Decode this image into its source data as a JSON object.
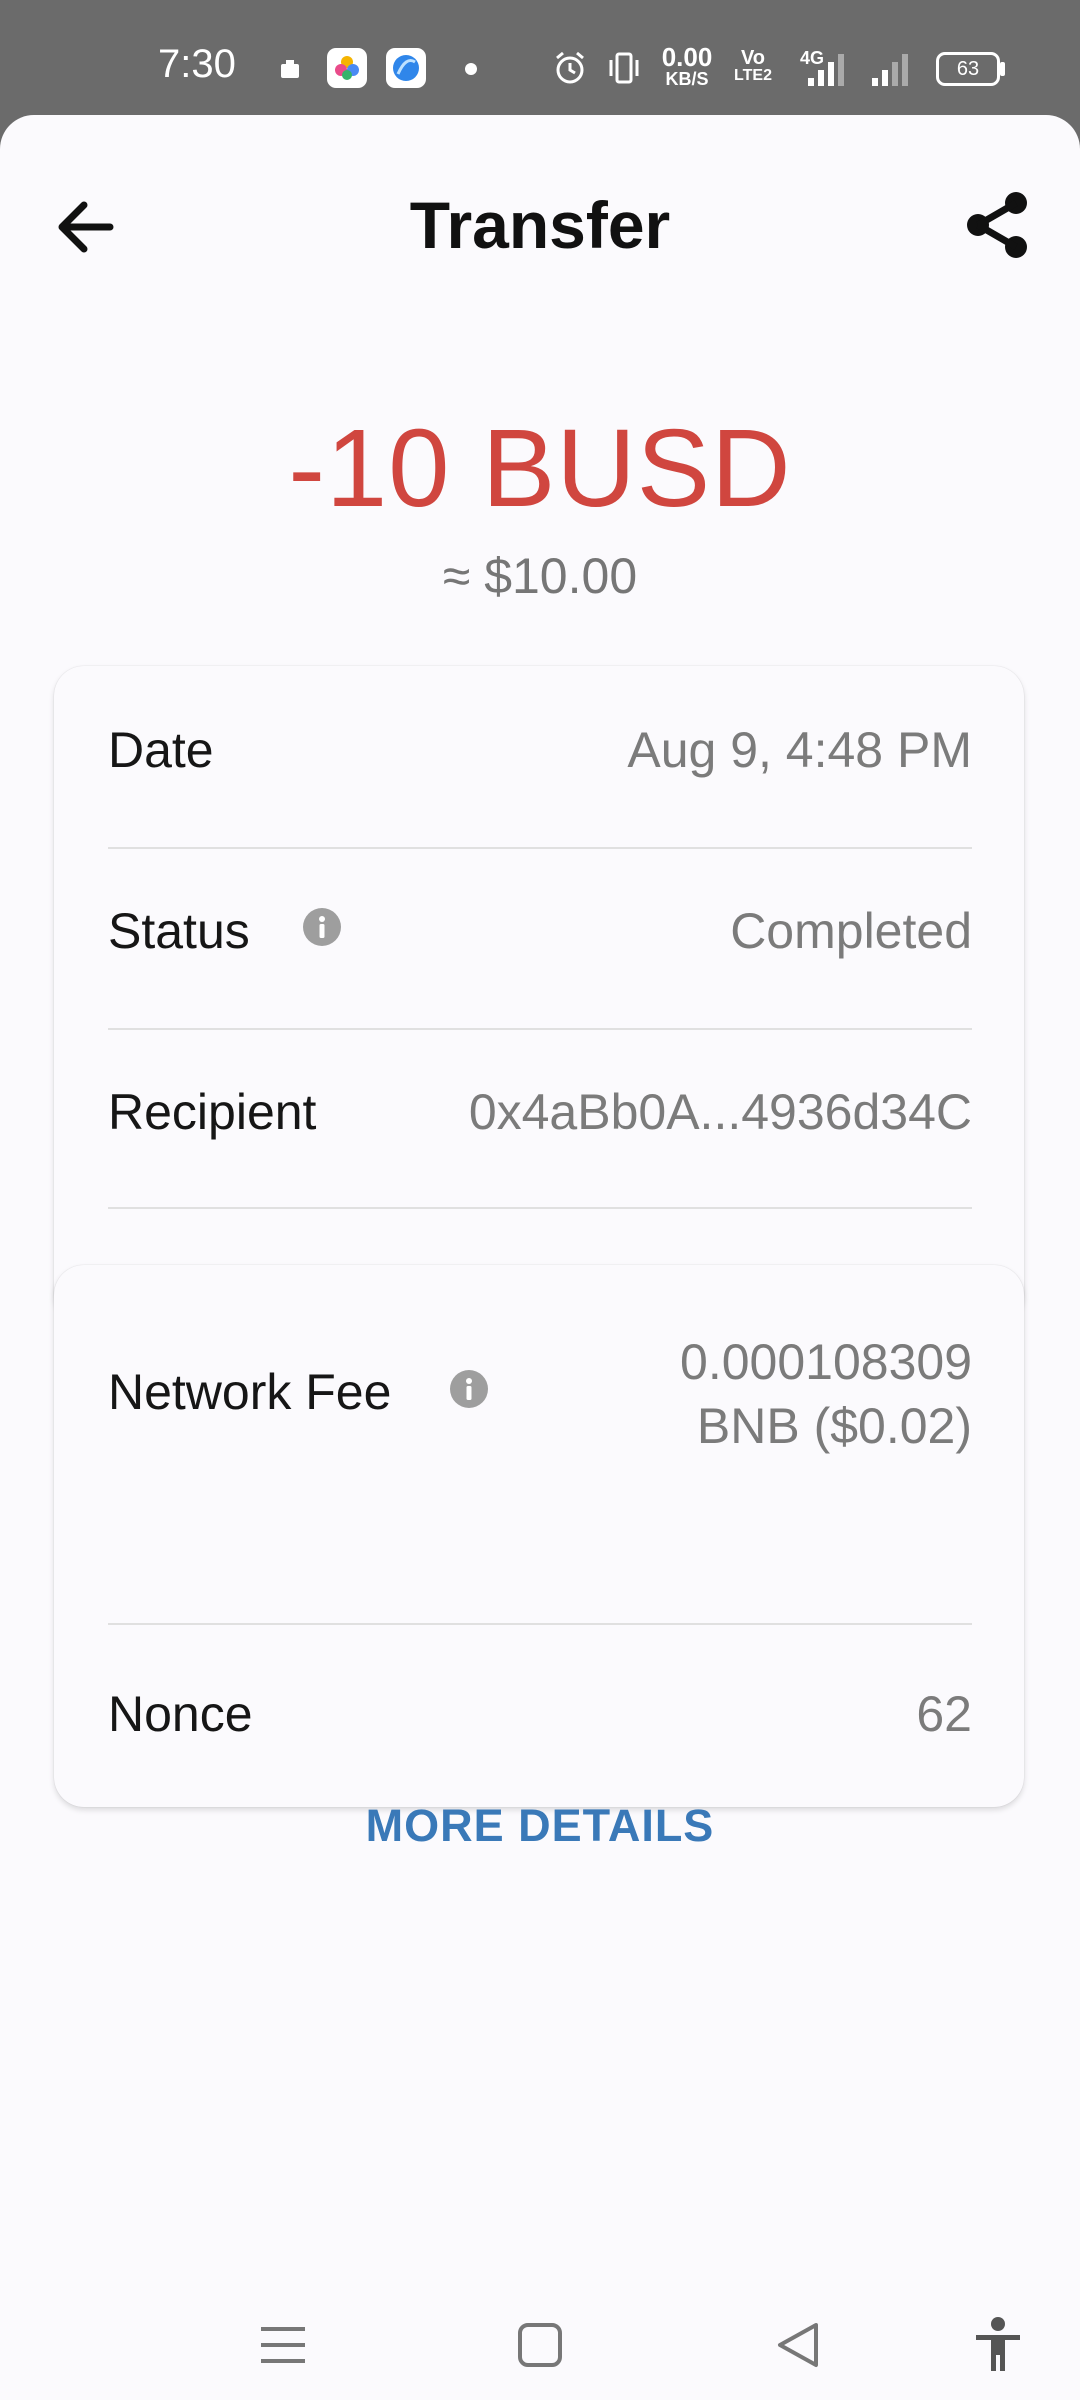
{
  "status_bar": {
    "time": "7:30",
    "network_speed": "0.00",
    "network_speed_unit": "KB/S",
    "carrier_top": "Vo",
    "carrier_bottom": "LTE2",
    "network_type": "4G",
    "battery": "63"
  },
  "header": {
    "title": "Transfer",
    "back_icon": "arrow-left-icon",
    "share_icon": "share-icon"
  },
  "summary": {
    "amount": "-10 BUSD",
    "fiat": "≈ $10.00",
    "amount_color": "#d0463f"
  },
  "details": {
    "date_label": "Date",
    "date_value": "Aug 9, 4:48 PM",
    "status_label": "Status",
    "status_value": "Completed",
    "recipient_label": "Recipient",
    "recipient_value": "0x4aBb0A...4936d34C"
  },
  "fees": {
    "network_fee_label": "Network Fee",
    "network_fee_line1": "0.000108309",
    "network_fee_line2": "BNB ($0.02)",
    "nonce_label": "Nonce",
    "nonce_value": "62"
  },
  "more_details_label": "MORE DETAILS",
  "accent_color": "#3a79b8",
  "nav": {
    "menu_icon": "menu-icon",
    "home_icon": "home-square-icon",
    "back_icon": "back-triangle-icon",
    "accessibility_icon": "accessibility-icon"
  }
}
